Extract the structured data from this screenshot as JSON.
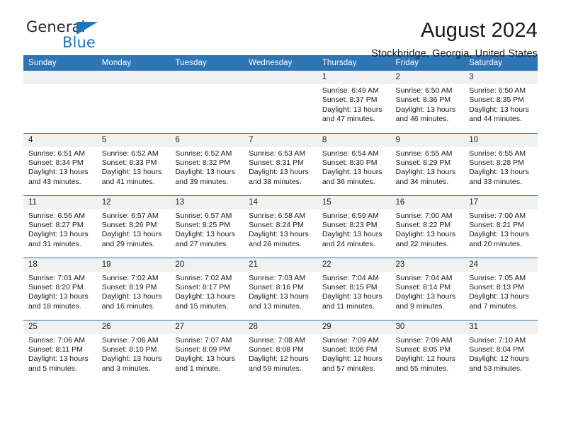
{
  "logo": {
    "text_dark": "General",
    "text_blue": "Blue",
    "accent_color": "#1b75bb"
  },
  "header": {
    "title": "August 2024",
    "subtitle": "Stockbridge, Georgia, United States",
    "header_bg": "#2e75b6",
    "daynum_bg": "#f1f1f1"
  },
  "weekday_headers": [
    "Sunday",
    "Monday",
    "Tuesday",
    "Wednesday",
    "Thursday",
    "Friday",
    "Saturday"
  ],
  "labels": {
    "sunrise": "Sunrise:",
    "sunset": "Sunset:",
    "daylight": "Daylight:"
  },
  "weeks": [
    [
      {
        "day": "",
        "blank": true,
        "line1": "",
        "line2": "",
        "line3": "",
        "line4": ""
      },
      {
        "day": "",
        "blank": true,
        "line1": "",
        "line2": "",
        "line3": "",
        "line4": ""
      },
      {
        "day": "",
        "blank": true,
        "line1": "",
        "line2": "",
        "line3": "",
        "line4": ""
      },
      {
        "day": "",
        "blank": true,
        "line1": "",
        "line2": "",
        "line3": "",
        "line4": ""
      },
      {
        "day": "1",
        "blank": false,
        "line1": "Sunrise: 6:49 AM",
        "line2": "Sunset: 8:37 PM",
        "line3": "Daylight: 13 hours",
        "line4": "and 47 minutes."
      },
      {
        "day": "2",
        "blank": false,
        "line1": "Sunrise: 6:50 AM",
        "line2": "Sunset: 8:36 PM",
        "line3": "Daylight: 13 hours",
        "line4": "and 46 minutes."
      },
      {
        "day": "3",
        "blank": false,
        "line1": "Sunrise: 6:50 AM",
        "line2": "Sunset: 8:35 PM",
        "line3": "Daylight: 13 hours",
        "line4": "and 44 minutes."
      }
    ],
    [
      {
        "day": "4",
        "blank": false,
        "line1": "Sunrise: 6:51 AM",
        "line2": "Sunset: 8:34 PM",
        "line3": "Daylight: 13 hours",
        "line4": "and 43 minutes."
      },
      {
        "day": "5",
        "blank": false,
        "line1": "Sunrise: 6:52 AM",
        "line2": "Sunset: 8:33 PM",
        "line3": "Daylight: 13 hours",
        "line4": "and 41 minutes."
      },
      {
        "day": "6",
        "blank": false,
        "line1": "Sunrise: 6:52 AM",
        "line2": "Sunset: 8:32 PM",
        "line3": "Daylight: 13 hours",
        "line4": "and 39 minutes."
      },
      {
        "day": "7",
        "blank": false,
        "line1": "Sunrise: 6:53 AM",
        "line2": "Sunset: 8:31 PM",
        "line3": "Daylight: 13 hours",
        "line4": "and 38 minutes."
      },
      {
        "day": "8",
        "blank": false,
        "line1": "Sunrise: 6:54 AM",
        "line2": "Sunset: 8:30 PM",
        "line3": "Daylight: 13 hours",
        "line4": "and 36 minutes."
      },
      {
        "day": "9",
        "blank": false,
        "line1": "Sunrise: 6:55 AM",
        "line2": "Sunset: 8:29 PM",
        "line3": "Daylight: 13 hours",
        "line4": "and 34 minutes."
      },
      {
        "day": "10",
        "blank": false,
        "line1": "Sunrise: 6:55 AM",
        "line2": "Sunset: 8:28 PM",
        "line3": "Daylight: 13 hours",
        "line4": "and 33 minutes."
      }
    ],
    [
      {
        "day": "11",
        "blank": false,
        "line1": "Sunrise: 6:56 AM",
        "line2": "Sunset: 8:27 PM",
        "line3": "Daylight: 13 hours",
        "line4": "and 31 minutes."
      },
      {
        "day": "12",
        "blank": false,
        "line1": "Sunrise: 6:57 AM",
        "line2": "Sunset: 8:26 PM",
        "line3": "Daylight: 13 hours",
        "line4": "and 29 minutes."
      },
      {
        "day": "13",
        "blank": false,
        "line1": "Sunrise: 6:57 AM",
        "line2": "Sunset: 8:25 PM",
        "line3": "Daylight: 13 hours",
        "line4": "and 27 minutes."
      },
      {
        "day": "14",
        "blank": false,
        "line1": "Sunrise: 6:58 AM",
        "line2": "Sunset: 8:24 PM",
        "line3": "Daylight: 13 hours",
        "line4": "and 26 minutes."
      },
      {
        "day": "15",
        "blank": false,
        "line1": "Sunrise: 6:59 AM",
        "line2": "Sunset: 8:23 PM",
        "line3": "Daylight: 13 hours",
        "line4": "and 24 minutes."
      },
      {
        "day": "16",
        "blank": false,
        "line1": "Sunrise: 7:00 AM",
        "line2": "Sunset: 8:22 PM",
        "line3": "Daylight: 13 hours",
        "line4": "and 22 minutes."
      },
      {
        "day": "17",
        "blank": false,
        "line1": "Sunrise: 7:00 AM",
        "line2": "Sunset: 8:21 PM",
        "line3": "Daylight: 13 hours",
        "line4": "and 20 minutes."
      }
    ],
    [
      {
        "day": "18",
        "blank": false,
        "line1": "Sunrise: 7:01 AM",
        "line2": "Sunset: 8:20 PM",
        "line3": "Daylight: 13 hours",
        "line4": "and 18 minutes."
      },
      {
        "day": "19",
        "blank": false,
        "line1": "Sunrise: 7:02 AM",
        "line2": "Sunset: 8:19 PM",
        "line3": "Daylight: 13 hours",
        "line4": "and 16 minutes."
      },
      {
        "day": "20",
        "blank": false,
        "line1": "Sunrise: 7:02 AM",
        "line2": "Sunset: 8:17 PM",
        "line3": "Daylight: 13 hours",
        "line4": "and 15 minutes."
      },
      {
        "day": "21",
        "blank": false,
        "line1": "Sunrise: 7:03 AM",
        "line2": "Sunset: 8:16 PM",
        "line3": "Daylight: 13 hours",
        "line4": "and 13 minutes."
      },
      {
        "day": "22",
        "blank": false,
        "line1": "Sunrise: 7:04 AM",
        "line2": "Sunset: 8:15 PM",
        "line3": "Daylight: 13 hours",
        "line4": "and 11 minutes."
      },
      {
        "day": "23",
        "blank": false,
        "line1": "Sunrise: 7:04 AM",
        "line2": "Sunset: 8:14 PM",
        "line3": "Daylight: 13 hours",
        "line4": "and 9 minutes."
      },
      {
        "day": "24",
        "blank": false,
        "line1": "Sunrise: 7:05 AM",
        "line2": "Sunset: 8:13 PM",
        "line3": "Daylight: 13 hours",
        "line4": "and 7 minutes."
      }
    ],
    [
      {
        "day": "25",
        "blank": false,
        "line1": "Sunrise: 7:06 AM",
        "line2": "Sunset: 8:11 PM",
        "line3": "Daylight: 13 hours",
        "line4": "and 5 minutes."
      },
      {
        "day": "26",
        "blank": false,
        "line1": "Sunrise: 7:06 AM",
        "line2": "Sunset: 8:10 PM",
        "line3": "Daylight: 13 hours",
        "line4": "and 3 minutes."
      },
      {
        "day": "27",
        "blank": false,
        "line1": "Sunrise: 7:07 AM",
        "line2": "Sunset: 8:09 PM",
        "line3": "Daylight: 13 hours",
        "line4": "and 1 minute."
      },
      {
        "day": "28",
        "blank": false,
        "line1": "Sunrise: 7:08 AM",
        "line2": "Sunset: 8:08 PM",
        "line3": "Daylight: 12 hours",
        "line4": "and 59 minutes."
      },
      {
        "day": "29",
        "blank": false,
        "line1": "Sunrise: 7:09 AM",
        "line2": "Sunset: 8:06 PM",
        "line3": "Daylight: 12 hours",
        "line4": "and 57 minutes."
      },
      {
        "day": "30",
        "blank": false,
        "line1": "Sunrise: 7:09 AM",
        "line2": "Sunset: 8:05 PM",
        "line3": "Daylight: 12 hours",
        "line4": "and 55 minutes."
      },
      {
        "day": "31",
        "blank": false,
        "line1": "Sunrise: 7:10 AM",
        "line2": "Sunset: 8:04 PM",
        "line3": "Daylight: 12 hours",
        "line4": "and 53 minutes."
      }
    ]
  ]
}
